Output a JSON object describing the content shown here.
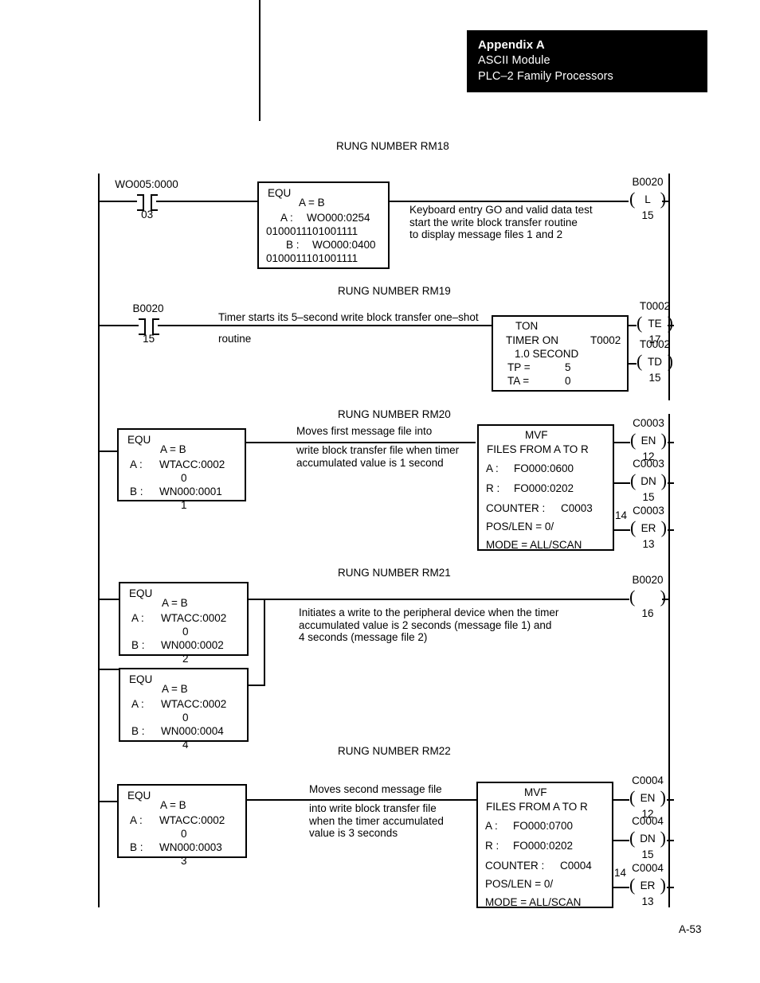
{
  "header": {
    "appendix": "Appendix A",
    "module": "ASCII Module",
    "family": "PLC–2 Family Processors"
  },
  "footer": {
    "page_number": "A-53"
  },
  "rungs": [
    {
      "id": "RM18",
      "title": "RUNG NUMBER RM18",
      "contact": {
        "label": "WO005:0000",
        "address": "03"
      },
      "block": {
        "type": "EQU",
        "relation": "A  =  B",
        "a_label": "A  :",
        "a_value": "WO000:0254",
        "a_extra": "0100011101001111",
        "b_label": "B  :",
        "b_value": "WO000:0400",
        "b_extra": "0100011101001111"
      },
      "comment": "Keyboard entry GO and valid data test\nstart the write block transfer routine\nto display message files 1 and 2",
      "outputs": [
        {
          "name": "B0020",
          "symbol": "L",
          "address": "15"
        }
      ]
    },
    {
      "id": "RM19",
      "title": "RUNG NUMBER RM19",
      "contact": {
        "label": "B0020",
        "address": "15"
      },
      "comment_line1": "Timer starts its 5–second write block transfer one–shot",
      "comment_line2": "routine",
      "block": {
        "type": "TON",
        "name": "TIMER ON",
        "reference": "T0002",
        "time_base": "1.0 SECOND",
        "tp_label": "TP  =",
        "tp_value": "5",
        "ta_label": "TA  =",
        "ta_value": "0"
      },
      "outputs": [
        {
          "name": "T0002",
          "symbol": "TE",
          "address": "17"
        },
        {
          "name": "T0002",
          "symbol": "TD",
          "address": "15"
        }
      ]
    },
    {
      "id": "RM20",
      "title": "RUNG NUMBER RM20",
      "block": {
        "type": "EQU",
        "relation": "A  =  B",
        "a_label": "A  :",
        "a_value": "WTACC:0002",
        "a_extra": "0",
        "b_label": "B  :",
        "b_value": "WN000:0001",
        "b_extra": "1"
      },
      "comment_top": "Moves first message file into",
      "comment_bottom": "write block transfer file when timer\naccumulated value is 1 second",
      "mvf": {
        "type": "MVF",
        "subtitle": "FILES FROM A  TO  R",
        "a_label": "A  :",
        "a_value": "FO000:0600",
        "r_label": "R  :",
        "r_value": "FO000:0202",
        "counter_label": "COUNTER  :",
        "counter_value": "C0003",
        "poslen": "POS/LEN  =  0/",
        "mode": "MODE  =  ALL/SCAN"
      },
      "marker": "14",
      "outputs": [
        {
          "name": "C0003",
          "symbol": "EN",
          "address": "12"
        },
        {
          "name": "C0003",
          "symbol": "DN",
          "address": "15"
        },
        {
          "name": "C0003",
          "symbol": "ER",
          "address": "13"
        }
      ]
    },
    {
      "id": "RM21",
      "title": "RUNG NUMBER RM21",
      "block": {
        "type": "EQU",
        "relation": "A  =  B",
        "a_label": "A  :",
        "a_value": "WTACC:0002",
        "a_extra": "0",
        "b_label": "B  :",
        "b_value": "WN000:0002",
        "b_extra": "2"
      },
      "block2": {
        "type": "EQU",
        "relation": "A  =  B",
        "a_label": "A  :",
        "a_value": "WTACC:0002",
        "a_extra": "0",
        "b_label": "B  :",
        "b_value": "WN000:0004",
        "b_extra": "4"
      },
      "comment": "Initiates a write to the peripheral device when the timer\naccumulated value is 2 seconds (message file 1) and\n4 seconds (message file 2)",
      "outputs": [
        {
          "name": "B0020",
          "symbol": "",
          "address": "16"
        }
      ]
    },
    {
      "id": "RM22",
      "title": "RUNG NUMBER RM22",
      "block": {
        "type": "EQU",
        "relation": "A  =  B",
        "a_label": "A  :",
        "a_value": "WTACC:0002",
        "a_extra": "0",
        "b_label": "B  :",
        "b_value": "WN000:0003",
        "b_extra": "3"
      },
      "comment_top": "Moves second message file",
      "comment_bottom": "into write block transfer file\nwhen the timer accumulated\nvalue is 3 seconds",
      "mvf": {
        "type": "MVF",
        "subtitle": "FILES FROM A  TO  R",
        "a_label": "A  :",
        "a_value": "FO000:0700",
        "r_label": "R  :",
        "r_value": "FO000:0202",
        "counter_label": "COUNTER  :",
        "counter_value": "C0004",
        "poslen": "POS/LEN  =  0/",
        "mode": "MODE  =  ALL/SCAN"
      },
      "marker": "14",
      "outputs": [
        {
          "name": "C0004",
          "symbol": "EN",
          "address": "12"
        },
        {
          "name": "C0004",
          "symbol": "DN",
          "address": "15"
        },
        {
          "name": "C0004",
          "symbol": "ER",
          "address": "13"
        }
      ]
    }
  ]
}
